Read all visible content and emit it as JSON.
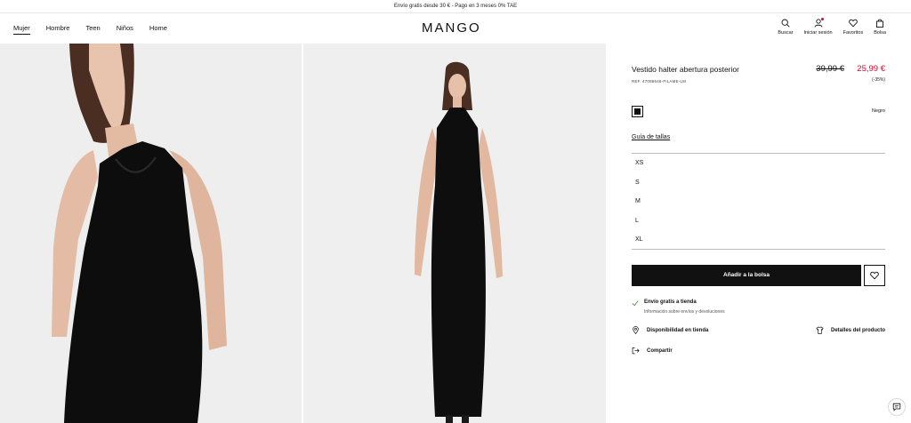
{
  "promo": "Envío gratis desde 30 € - Pago en 3 meses 0% TAE",
  "nav": [
    "Mujer",
    "Hombre",
    "Teen",
    "Niños",
    "Home"
  ],
  "logo": "MANGO",
  "tools": {
    "search": "Buscar",
    "login": "Iniciar sesión",
    "favorites": "Favoritos",
    "bag": "Bolsa"
  },
  "product": {
    "title": "Vestido halter abertura posterior",
    "ref": "REF. 47088646-FILAME-LM",
    "old_price": "39,99 €",
    "new_price": "25,99 €",
    "discount": "(-35%)",
    "color": "Negro",
    "size_guide": "Guía de tallas",
    "sizes": [
      "XS",
      "S",
      "M",
      "L",
      "XL"
    ],
    "add_to_bag": "Añadir a la bolsa",
    "shipping_title": "Envío gratis a tienda",
    "shipping_info": "Información sobre envíos y devoluciones",
    "availability": "Disponibilidad en tienda",
    "details": "Detalles del producto",
    "share": "Compartir"
  },
  "colors": {
    "accent_sale": "#e4002b",
    "button": "#111111"
  }
}
